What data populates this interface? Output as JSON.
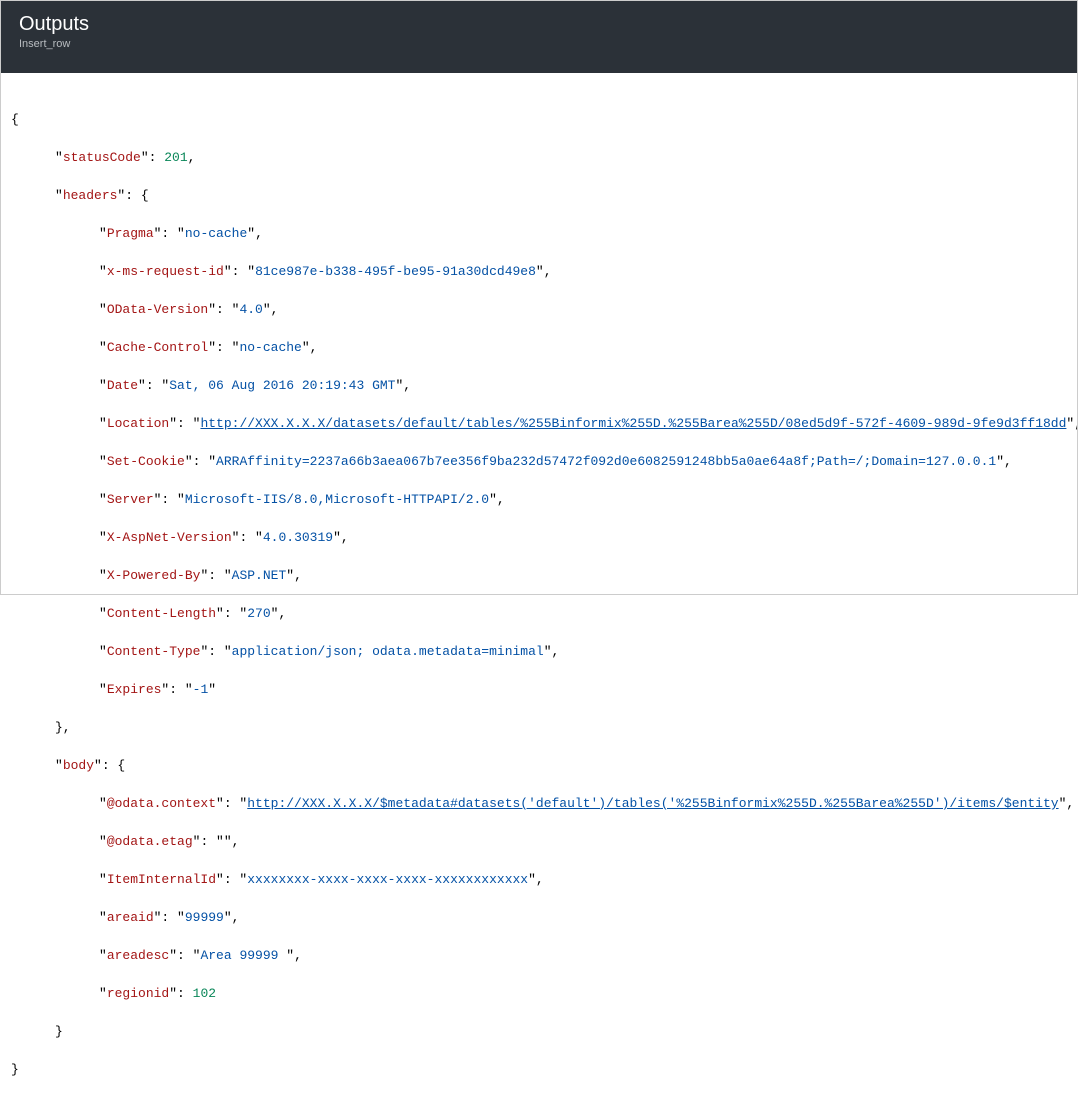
{
  "header": {
    "title": "Outputs",
    "subtitle": "Insert_row"
  },
  "json": {
    "statusCode_key": "statusCode",
    "statusCode_val": "201",
    "headers_key": "headers",
    "headers": {
      "Pragma_key": "Pragma",
      "Pragma_val": "no-cache",
      "x_ms_request_id_key": "x-ms-request-id",
      "x_ms_request_id_val": "81ce987e-b338-495f-be95-91a30dcd49e8",
      "OData_Version_key": "OData-Version",
      "OData_Version_val": "4.0",
      "Cache_Control_key": "Cache-Control",
      "Cache_Control_val": "no-cache",
      "Date_key": "Date",
      "Date_val": "Sat, 06 Aug 2016 20:19:43 GMT",
      "Location_key": "Location",
      "Location_val": "http://XXX.X.X.X/datasets/default/tables/%255Binformix%255D.%255Barea%255D/08ed5d9f-572f-4609-989d-9fe9d3ff18dd",
      "Set_Cookie_key": "Set-Cookie",
      "Set_Cookie_val": "ARRAffinity=2237a66b3aea067b7ee356f9ba232d57472f092d0e6082591248bb5a0ae64a8f;Path=/;Domain=127.0.0.1",
      "Server_key": "Server",
      "Server_val": "Microsoft-IIS/8.0,Microsoft-HTTPAPI/2.0",
      "X_AspNet_Version_key": "X-AspNet-Version",
      "X_AspNet_Version_val": "4.0.30319",
      "X_Powered_By_key": "X-Powered-By",
      "X_Powered_By_val": "ASP.NET",
      "Content_Length_key": "Content-Length",
      "Content_Length_val": "270",
      "Content_Type_key": "Content-Type",
      "Content_Type_val": "application/json; odata.metadata=minimal",
      "Expires_key": "Expires",
      "Expires_val": "-1"
    },
    "body_key": "body",
    "body": {
      "odata_context_key": "@odata.context",
      "odata_context_val": "http://XXX.X.X.X/$metadata#datasets('default')/tables('%255Binformix%255D.%255Barea%255D')/items/$entity",
      "odata_etag_key": "@odata.etag",
      "odata_etag_val": "",
      "ItemInternalId_key": "ItemInternalId",
      "ItemInternalId_val": "xxxxxxxx-xxxx-xxxx-xxxx-xxxxxxxxxxxx",
      "areaid_key": "areaid",
      "areaid_val": "99999",
      "areadesc_key": "areadesc",
      "areadesc_val": "Area 99999 ",
      "regionid_key": "regionid",
      "regionid_val": "102"
    }
  }
}
